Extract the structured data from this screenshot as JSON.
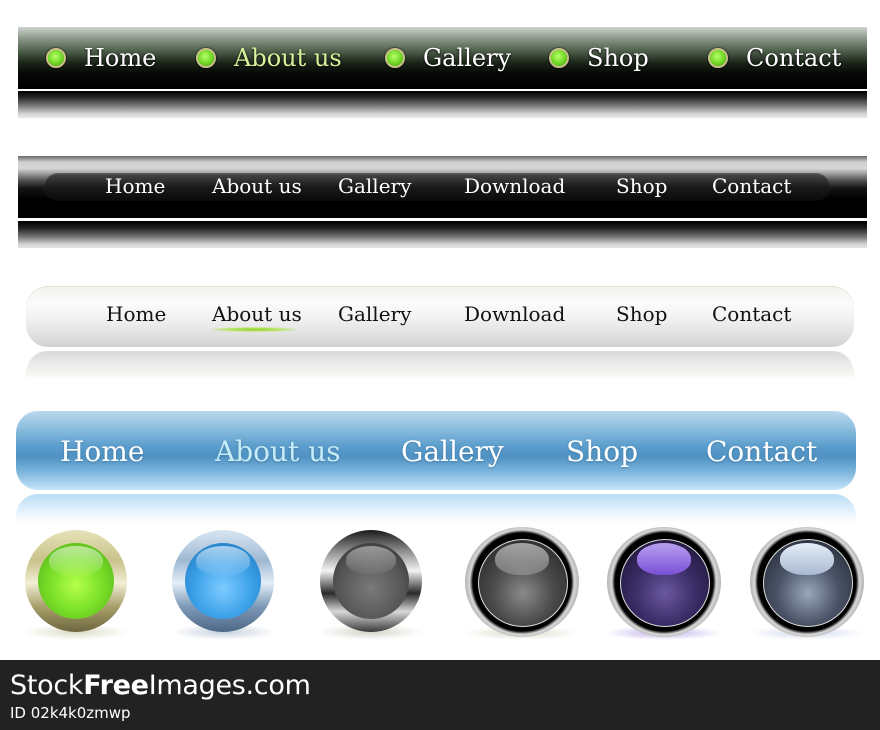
{
  "navbars": [
    {
      "style": "dark-green-glossy",
      "items": [
        {
          "label": "Home",
          "active": false
        },
        {
          "label": "About us",
          "active": true
        },
        {
          "label": "Gallery",
          "active": false
        },
        {
          "label": "Shop",
          "active": false
        },
        {
          "label": "Contact",
          "active": false
        }
      ],
      "bullet_icon": "green-orb-icon",
      "active_color": "#d8f29a"
    },
    {
      "style": "black-glossy",
      "items": [
        {
          "label": "Home"
        },
        {
          "label": "About us"
        },
        {
          "label": "Gallery"
        },
        {
          "label": "Download"
        },
        {
          "label": "Shop"
        },
        {
          "label": "Contact"
        }
      ]
    },
    {
      "style": "white-glossy",
      "items": [
        {
          "label": "Home",
          "active": false
        },
        {
          "label": "About us",
          "active": true
        },
        {
          "label": "Gallery",
          "active": false
        },
        {
          "label": "Download",
          "active": false
        },
        {
          "label": "Shop",
          "active": false
        },
        {
          "label": "Contact",
          "active": false
        }
      ],
      "active_indicator_color": "#8fd42a"
    },
    {
      "style": "blue-glossy",
      "items": [
        {
          "label": "Home",
          "active": false
        },
        {
          "label": "About us",
          "active": true
        },
        {
          "label": "Gallery",
          "active": false
        },
        {
          "label": "Shop",
          "active": false
        },
        {
          "label": "Contact",
          "active": false
        }
      ],
      "active_color": "#c6ecf6"
    }
  ],
  "buttons": [
    {
      "name": "green-glossy-button",
      "color": "#6ed624",
      "ring": "gold"
    },
    {
      "name": "blue-glossy-button",
      "color": "#3aa0e8",
      "ring": "steel-blue"
    },
    {
      "name": "gray-glossy-button",
      "color": "#5a5a5a",
      "ring": "chrome"
    },
    {
      "name": "dark-gray-glossy-button",
      "color": "#3a3a3a",
      "ring": "chrome-black"
    },
    {
      "name": "purple-glossy-button",
      "color": "#6a4fc0",
      "ring": "chrome-black"
    },
    {
      "name": "silver-blue-glossy-button",
      "color": "#8ea4c4",
      "ring": "chrome-black"
    }
  ],
  "footer": {
    "brand_prefix": "Stock",
    "brand_bold": "Free",
    "brand_suffix": "Images.com",
    "image_id": "ID 02k4k0zmwp"
  }
}
